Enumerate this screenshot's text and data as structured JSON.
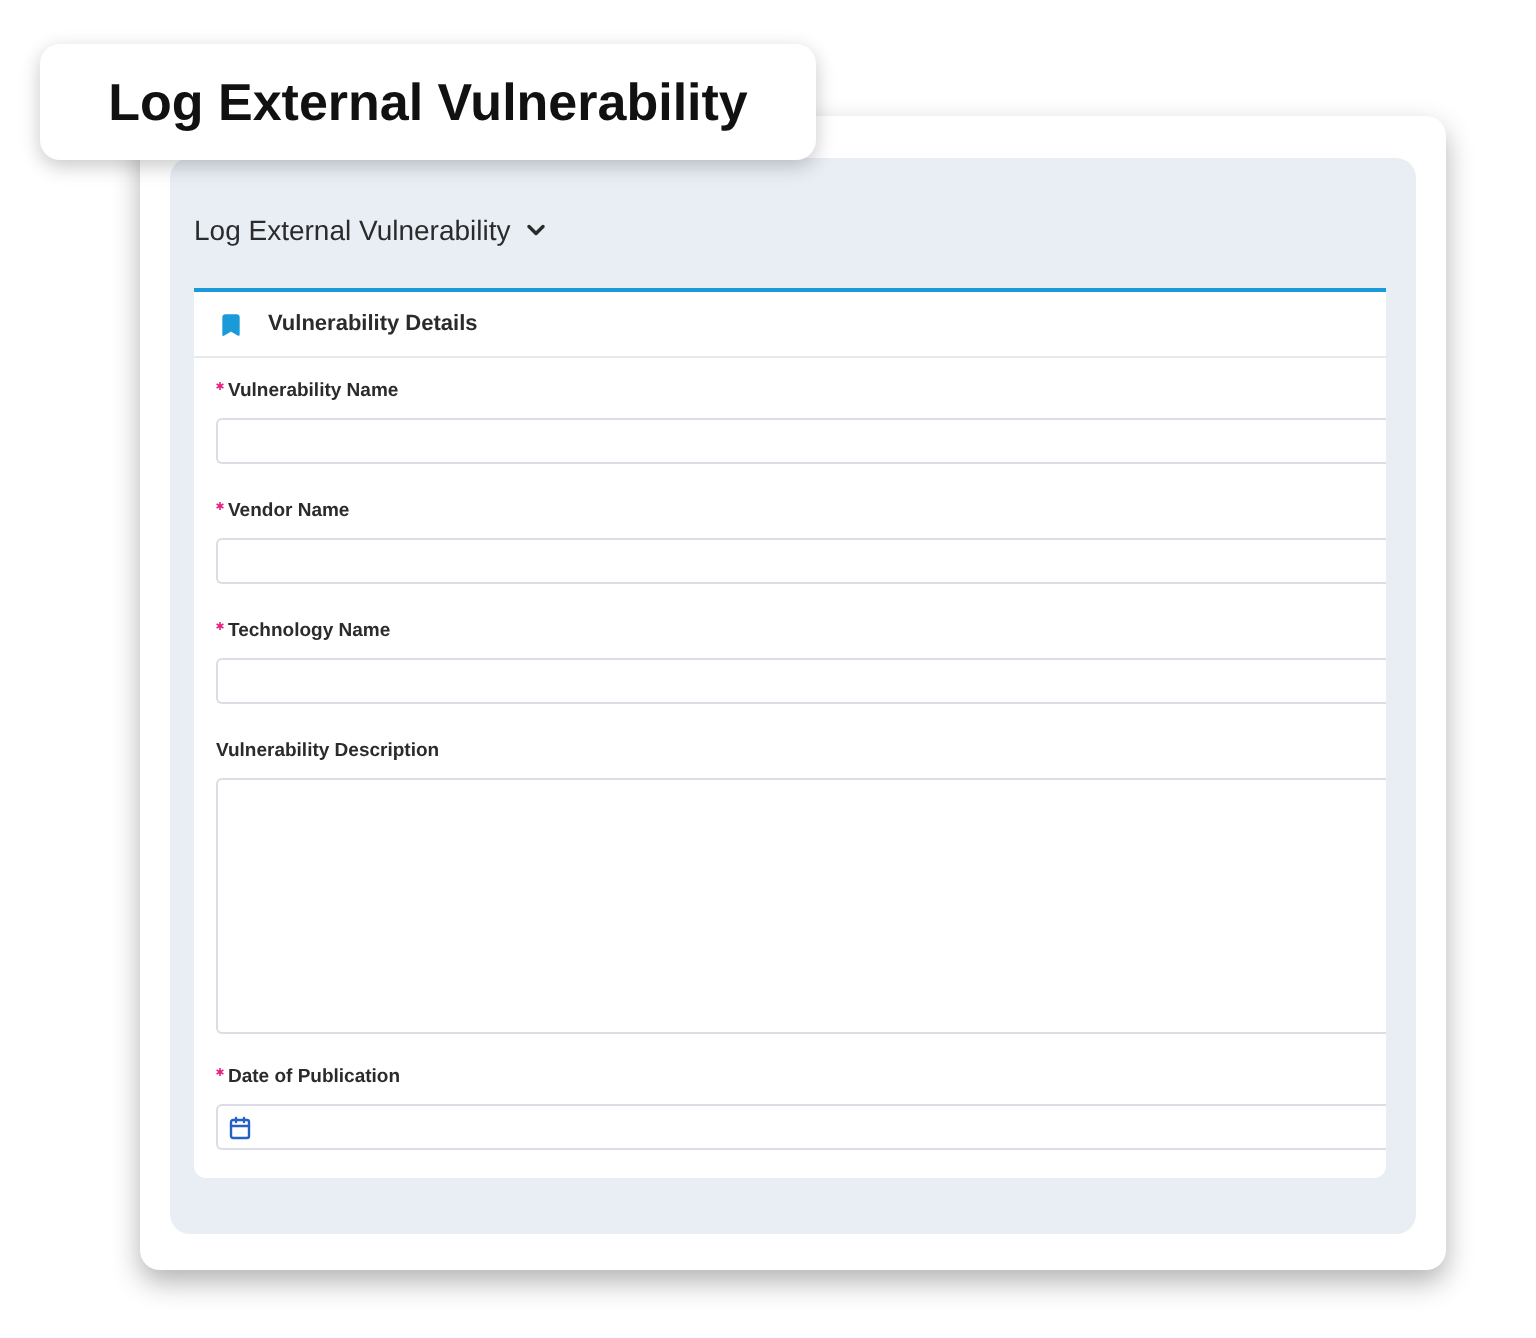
{
  "badge": {
    "title": "Log External Vulnerability"
  },
  "panel": {
    "title": "Log External Vulnerability",
    "expanded": true
  },
  "section": {
    "title": "Vulnerability Details"
  },
  "fields": [
    {
      "label": "Vulnerability Name",
      "required": true,
      "kind": "text"
    },
    {
      "label": "Vendor Name",
      "required": true,
      "kind": "text"
    },
    {
      "label": "Technology Name",
      "required": true,
      "kind": "text"
    },
    {
      "label": "Vulnerability Description",
      "required": false,
      "kind": "textarea"
    },
    {
      "label": "Date of Publication",
      "required": true,
      "kind": "date"
    }
  ]
}
